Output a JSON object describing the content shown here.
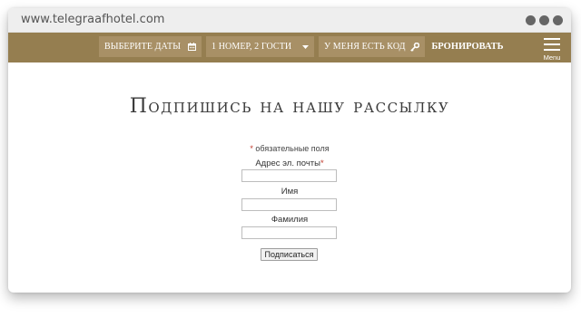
{
  "browser": {
    "url": "www.telegraafhotel.com"
  },
  "booking_bar": {
    "dates_label": "ВЫБЕРИТЕ ДАТЫ",
    "dates_icon": "calendar-icon",
    "guests_label": "1 НОМЕР, 2 ГОСТИ",
    "guests_icon": "caret-down-icon",
    "code_label": "У МЕНЯ ЕСТЬ КОД",
    "code_icon": "key-icon",
    "book_label": "БРОНИРОВАТЬ",
    "menu_label": "Menu",
    "menu_icon": "hamburger-icon",
    "bar_color": "#957e50",
    "field_color": "#a89066"
  },
  "newsletter": {
    "title": "Подпишись на нашу рассылку",
    "required_note_star": "*",
    "required_note": "обязательные поля",
    "email_label": "Адрес эл. почты",
    "email_star": "*",
    "email_value": "",
    "first_name_label": "Имя",
    "first_name_value": "",
    "last_name_label": "Фамилия",
    "last_name_value": "",
    "submit_label": "Подписаться"
  }
}
